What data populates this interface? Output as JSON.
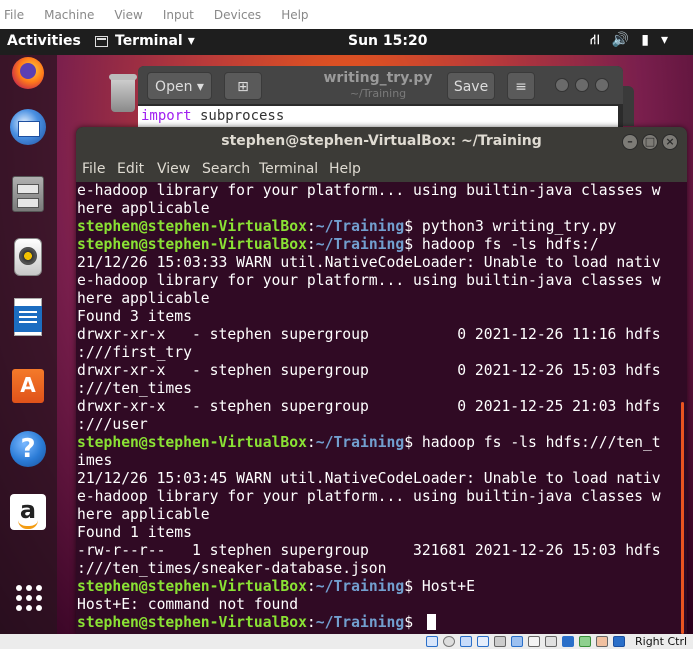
{
  "vbox_menu": {
    "items": [
      "File",
      "Machine",
      "View",
      "Input",
      "Devices",
      "Help"
    ]
  },
  "top_panel": {
    "activities": "Activities",
    "app_name": "Terminal",
    "app_arrow": "▾",
    "clock": "Sun 15:20",
    "tray": {
      "network": "⛙",
      "volume": "🔊",
      "battery": "▮",
      "arrow": "▾"
    }
  },
  "dock": {
    "apps": [
      "firefox-icon",
      "thunderbird-icon",
      "files-icon",
      "rhythmbox-icon",
      "libreoffice-writer-icon",
      "software-center-icon",
      "help-icon",
      "amazon-icon",
      "show-applications-icon"
    ],
    "amazon_letter": "a",
    "help_glyph": "?",
    "store_glyph": "A"
  },
  "gedit": {
    "open_label": "Open",
    "open_arrow": "▾",
    "title": "writing_try.py",
    "subtitle": "~/Training",
    "save_label": "Save",
    "menu_glyph": "≡",
    "pin_glyph": "⊞",
    "code_keyword": "import",
    "code_rest": " subprocess"
  },
  "terminal": {
    "title": "stephen@stephen-VirtualBox: ~/Training",
    "menu": [
      "File",
      "Edit",
      "View",
      "Search",
      "Terminal",
      "Help"
    ],
    "controls": {
      "minimize": "–",
      "maximize": "□",
      "close": "×"
    },
    "prompt_user": "stephen@stephen-VirtualBox",
    "prompt_sep": ":",
    "prompt_path": "~/Training",
    "prompt_dollar": "$ ",
    "lines": [
      {
        "text": "e-hadoop library for your platform... using builtin-java classes w"
      },
      {
        "text": "here applicable"
      },
      {
        "cmd": "python3 writing_try.py"
      },
      {
        "cmd": "hadoop fs -ls hdfs:/"
      },
      {
        "text": "21/12/26 15:03:33 WARN util.NativeCodeLoader: Unable to load nativ"
      },
      {
        "text": "e-hadoop library for your platform... using builtin-java classes w"
      },
      {
        "text": "here applicable"
      },
      {
        "text": "Found 3 items"
      },
      {
        "text": "drwxr-xr-x   - stephen supergroup          0 2021-12-26 11:16 hdfs"
      },
      {
        "text": ":///first_try"
      },
      {
        "text": "drwxr-xr-x   - stephen supergroup          0 2021-12-26 15:03 hdfs"
      },
      {
        "text": ":///ten_times"
      },
      {
        "text": "drwxr-xr-x   - stephen supergroup          0 2021-12-25 21:03 hdfs"
      },
      {
        "text": ":///user"
      },
      {
        "cmd": "hadoop fs -ls hdfs:///ten_t"
      },
      {
        "text": "imes"
      },
      {
        "text": "21/12/26 15:03:45 WARN util.NativeCodeLoader: Unable to load nativ"
      },
      {
        "text": "e-hadoop library for your platform... using builtin-java classes w"
      },
      {
        "text": "here applicable"
      },
      {
        "text": "Found 1 items"
      },
      {
        "text": "-rw-r--r--   1 stephen supergroup     321681 2021-12-26 15:03 hdfs"
      },
      {
        "text": ":///ten_times/sneaker-database.json"
      },
      {
        "cmd": "Host+E"
      },
      {
        "text": "Host+E: command not found"
      },
      {
        "cmd": "",
        "cursor": true
      }
    ]
  },
  "vbox_status": {
    "host_key": "Right Ctrl"
  }
}
